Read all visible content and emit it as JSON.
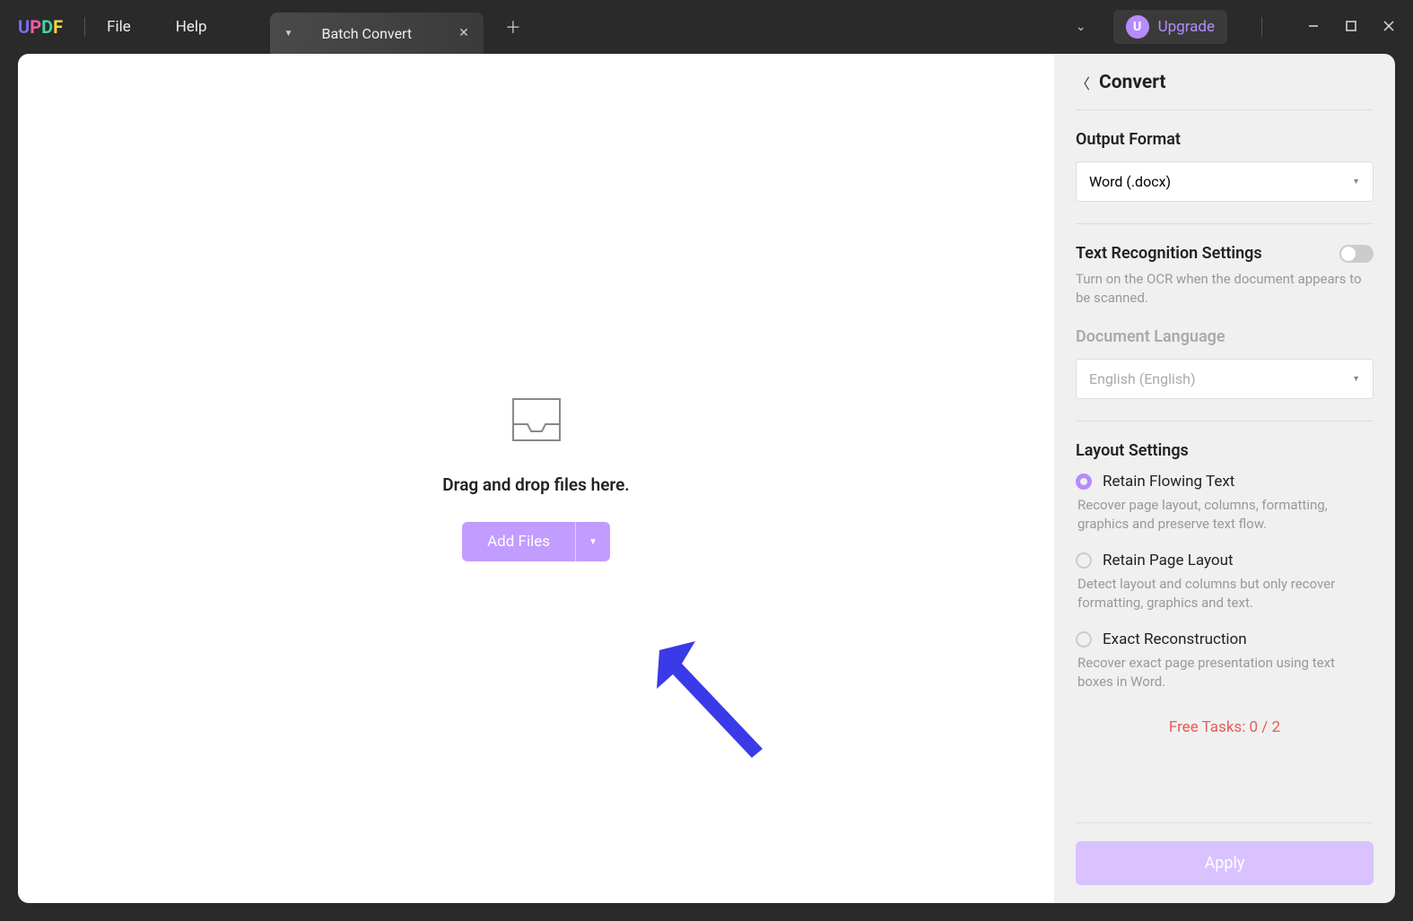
{
  "logo": {
    "u": "U",
    "p": "P",
    "d": "D",
    "f": "F"
  },
  "menu": {
    "file": "File",
    "help": "Help"
  },
  "tab": {
    "label": "Batch Convert"
  },
  "upgrade": {
    "badge": "U",
    "text": "Upgrade"
  },
  "dropzone": {
    "text": "Drag and drop files here.",
    "button": "Add Files"
  },
  "panel": {
    "title": "Convert",
    "output_format": {
      "label": "Output Format",
      "value": "Word (.docx)"
    },
    "ocr": {
      "label": "Text Recognition Settings",
      "desc": "Turn on the OCR when the document appears to be scanned."
    },
    "language": {
      "label": "Document Language",
      "value": "English (English)"
    },
    "layout": {
      "label": "Layout Settings",
      "options": [
        {
          "label": "Retain Flowing Text",
          "desc": "Recover page layout, columns, formatting, graphics and preserve text flow."
        },
        {
          "label": "Retain Page Layout",
          "desc": "Detect layout and columns but only recover formatting, graphics and text."
        },
        {
          "label": "Exact Reconstruction",
          "desc": "Recover exact page presentation using text boxes in Word."
        }
      ]
    },
    "free_tasks": "Free Tasks: 0 / 2",
    "apply": "Apply"
  }
}
